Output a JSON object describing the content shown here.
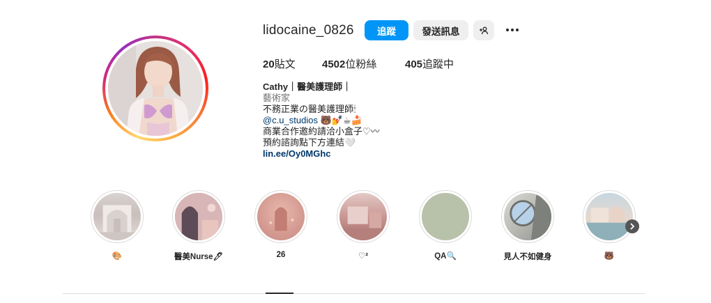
{
  "profile": {
    "username": "lidocaine_0826",
    "follow_label": "追蹤",
    "message_label": "發送訊息",
    "add_user_icon": "add-user-icon",
    "more_icon": "more-horizontal-icon"
  },
  "stats": {
    "posts_count": "20",
    "posts_label": "貼文",
    "followers_count": "4502",
    "followers_label": "位粉絲",
    "following_count": "405",
    "following_label": "追蹤中"
  },
  "bio": {
    "name": "Cathy｜醫美護理師｜",
    "category": "藝術家",
    "line1": "不務正業の醫美護理師🕯",
    "mention": "@c.u_studios",
    "mention_emoji": " 🐻💅☕🍰",
    "line3": "商業合作邀約請洽小盒子♡〰",
    "line4": "預約諮詢點下方連結🤍",
    "link": "lin.ee/Oy0MGhc"
  },
  "highlights": [
    {
      "label": "🎨"
    },
    {
      "label": "醫美Nurse🖊"
    },
    {
      "label": "26"
    },
    {
      "label": "♡²"
    },
    {
      "label": "QA🔍"
    },
    {
      "label": "見人不如健身"
    },
    {
      "label": "🐻"
    }
  ],
  "colors": {
    "follow_button": "#0095f6",
    "secondary_button": "#efefef",
    "link": "#00376b",
    "category_text": "#737373"
  }
}
